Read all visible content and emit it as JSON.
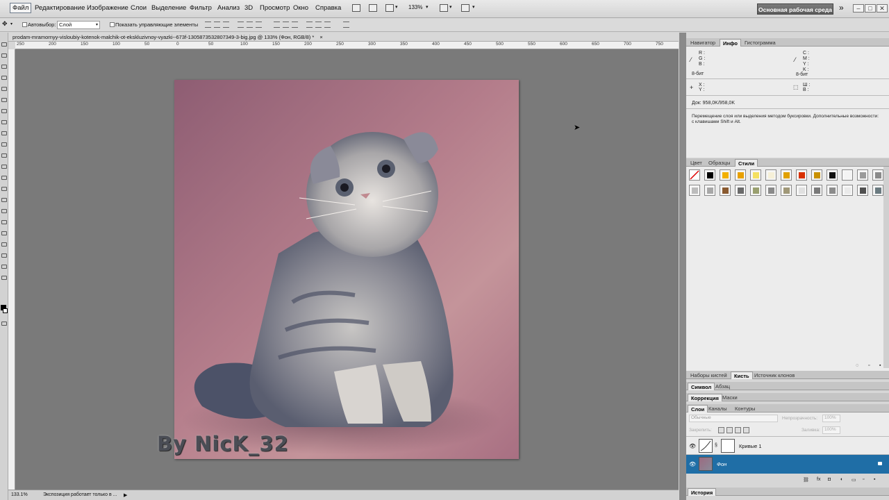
{
  "menubar": {
    "items": [
      "Файл",
      "Редактирование",
      "Изображение",
      "Слои",
      "Выделение",
      "Фильтр",
      "Анализ",
      "3D",
      "Просмотр",
      "Окно",
      "Справка"
    ],
    "zoom": "133%",
    "workspace": "Основная рабочая среда",
    "more": "»",
    "win_buttons": [
      "–",
      "□",
      "✕"
    ]
  },
  "options": {
    "autoselect_label": "Автовыбор:",
    "autoselect_value": "Слой",
    "show_controls": "Показать управляющие элементы"
  },
  "document": {
    "tab_title": "prodam-mramornyy-visloubiy-kotenok-malchik-ot-ekskluzivnoy-vyazki--673f-1305873532807349-3-big.jpg @ 133% (Фон, RGB/8) *",
    "close": "×",
    "ruler_marks": [
      "250",
      "200",
      "150",
      "100",
      "50",
      "0",
      "50",
      "100",
      "150",
      "200",
      "250",
      "300",
      "350",
      "400",
      "450",
      "500",
      "550",
      "600",
      "650",
      "700",
      "750"
    ],
    "watermark": "By NicK_32"
  },
  "status": {
    "zoom": "133.1%",
    "message": "Экспозиция работает только в ...",
    "arrow": "▶"
  },
  "info_panel": {
    "tabs": [
      "Навигатор",
      "Инфо",
      "Гистограмма"
    ],
    "active_tab": "Инфо",
    "rgb_labels": [
      "R :",
      "G :",
      "B :"
    ],
    "cmyk_labels": [
      "C :",
      "M :",
      "Y :",
      "K :"
    ],
    "bit_left": "8-бит",
    "bit_right": "8-бит",
    "xy_labels": [
      "X :",
      "Y :"
    ],
    "wh_labels": [
      "Ш :",
      "В :"
    ],
    "doc_size": "Док: 958,0K/958,0K",
    "hint": "Перемещение слоя или выделения методом буксировки. Дополнительные возможности: с клавишами Shift и Alt."
  },
  "styles_panel": {
    "tabs": [
      "Цвет",
      "Образцы",
      "Стили"
    ],
    "active_tab": "Стили",
    "row1": [
      "#ffffff",
      "#000000",
      "#f2b000",
      "#e8a000",
      "#f4e060",
      "#f6f0d8",
      "#e0a000",
      "#d83000",
      "#c89000",
      "#101010",
      "#f4f4f4",
      "#9a9a9a",
      "#8a8a8a"
    ],
    "row2": [
      "#bcbcbc",
      "#a8a8a8",
      "#8a5a30",
      "#6a6a6a",
      "#9aa070",
      "#8a8a8a",
      "#a09878",
      "#e0e0e0",
      "#7a7a7a",
      "#8c8c8c",
      "#eaeaea",
      "#505050",
      "#6a7a80"
    ]
  },
  "lower_tabs": {
    "brush": [
      "Наборы кистей",
      "Кисть",
      "Источник клонов"
    ],
    "brush_active": "Кисть",
    "char": [
      "Символ",
      "Абзац"
    ],
    "char_active": "Символ",
    "adj": [
      "Коррекция",
      "Маски"
    ],
    "adj_active": "Коррекция"
  },
  "layers_panel": {
    "tabs": [
      "Слои",
      "Каналы",
      "Контуры"
    ],
    "active_tab": "Слои",
    "blend_mode": "Обычные",
    "opacity_label": "Непрозрачность:",
    "opacity_value": "100%",
    "lock_label": "Закрепить:",
    "fill_label": "Заливка:",
    "fill_value": "100%",
    "layers": [
      {
        "name": "Кривые 1",
        "selected": false
      },
      {
        "name": "Фон",
        "selected": true
      }
    ],
    "history_tab": "История",
    "accent": "#1f6ea6"
  }
}
